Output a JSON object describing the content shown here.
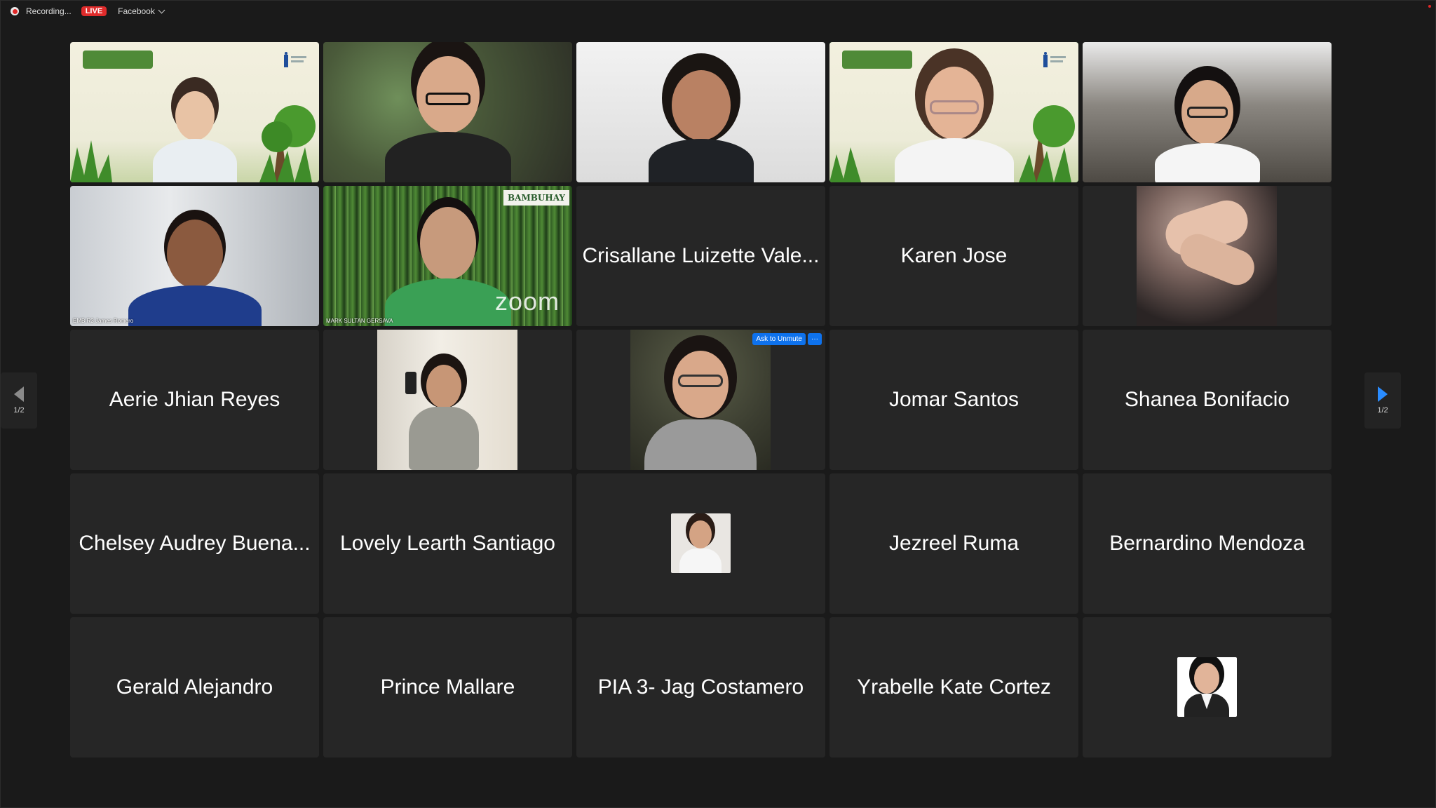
{
  "topbar": {
    "recording": "Recording...",
    "live": "LIVE",
    "stream_target": "Facebook"
  },
  "nav": {
    "page_left": "1/2",
    "page_right": "1/2"
  },
  "tiles": [
    {
      "type": "video",
      "note": "woman-backdrop"
    },
    {
      "type": "video",
      "note": "man-glasses"
    },
    {
      "type": "video",
      "note": "woman-headset"
    },
    {
      "type": "video",
      "note": "woman-backdrop-active"
    },
    {
      "type": "video",
      "note": "woman-glasses"
    },
    {
      "type": "video",
      "caption": "EMB R3 James Romero"
    },
    {
      "type": "video",
      "caption": "MARK SULTAN GERSAVA",
      "logo": "BAMBUHAY",
      "watermark": "zoom"
    },
    {
      "type": "name",
      "name": "Crisallane Luizette Vale..."
    },
    {
      "type": "name",
      "name": "Karen Jose"
    },
    {
      "type": "video",
      "note": "hands"
    },
    {
      "type": "name",
      "name": "Aerie Jhian Reyes"
    },
    {
      "type": "video",
      "note": "selfie"
    },
    {
      "type": "video",
      "note": "woman-smiling",
      "ask": "Ask to Unmute",
      "more": "···"
    },
    {
      "type": "name",
      "name": "Jomar Santos"
    },
    {
      "type": "name",
      "name": "Shanea Bonifacio"
    },
    {
      "type": "name",
      "name": "Chelsey Audrey Buena..."
    },
    {
      "type": "name",
      "name": "Lovely Learth Santiago"
    },
    {
      "type": "avatar",
      "note": "small-photo"
    },
    {
      "type": "name",
      "name": "Jezreel Ruma"
    },
    {
      "type": "name",
      "name": "Bernardino Mendoza"
    },
    {
      "type": "name",
      "name": "Gerald Alejandro"
    },
    {
      "type": "name",
      "name": "Prince Mallare"
    },
    {
      "type": "name",
      "name": "PIA 3- Jag Costamero"
    },
    {
      "type": "name",
      "name": "Yrabelle Kate Cortez"
    },
    {
      "type": "avatar",
      "note": "id-photo"
    }
  ],
  "colors": {
    "background": "#1a1a1a",
    "tile": "#262626",
    "active_speaker": "#2fbd48",
    "zoom_blue": "#0e72ed",
    "live_red": "#e02b2b"
  }
}
